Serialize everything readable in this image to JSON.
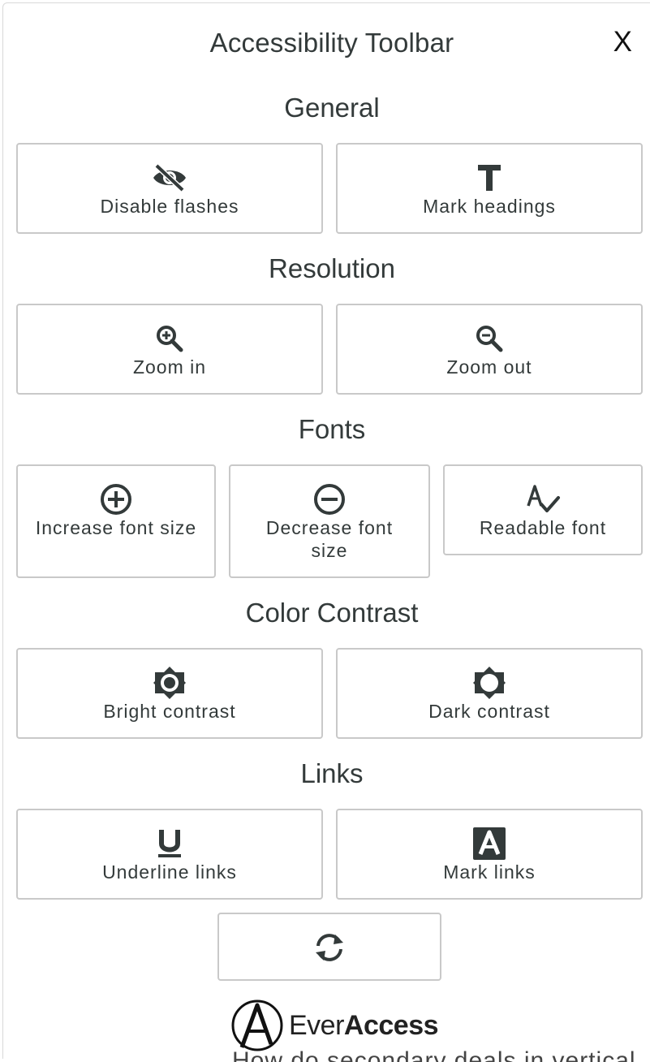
{
  "header": {
    "title": "Accessibility Toolbar",
    "close_label": "X"
  },
  "sections": {
    "general": {
      "title": "General",
      "disable_flashes": "Disable flashes",
      "mark_headings": "Mark headings"
    },
    "resolution": {
      "title": "Resolution",
      "zoom_in": "Zoom in",
      "zoom_out": "Zoom out"
    },
    "fonts": {
      "title": "Fonts",
      "increase": "Increase font size",
      "decrease": "Decrease font size",
      "readable": "Readable font"
    },
    "contrast": {
      "title": "Color Contrast",
      "bright": "Bright contrast",
      "dark": "Dark contrast"
    },
    "links": {
      "title": "Links",
      "underline": "Underline links",
      "mark": "Mark links"
    }
  },
  "icons": {
    "disable_flashes": "eye-slash-icon",
    "mark_headings": "heading-t-icon",
    "zoom_in": "zoom-in-icon",
    "zoom_out": "zoom-out-icon",
    "increase": "plus-circle-icon",
    "decrease": "minus-circle-icon",
    "readable": "font-check-icon",
    "bright": "brightness-icon",
    "dark": "brightness-dark-icon",
    "underline": "underline-icon",
    "mark": "marked-a-icon",
    "reset": "reset-sync-icon"
  },
  "footer": {
    "logo_text_light": "Ever",
    "logo_text_bold": "Access",
    "bleed_text": "How do secondary deals in vertical"
  },
  "colors": {
    "icon": "#333a3a",
    "border": "#c9c9c9",
    "text": "#333a3a"
  }
}
